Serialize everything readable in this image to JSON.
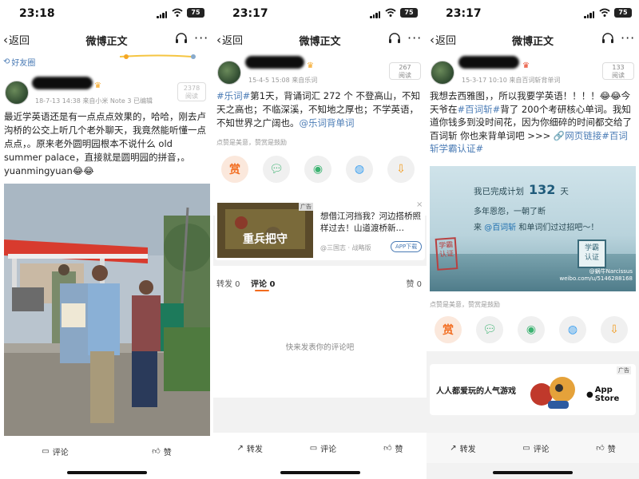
{
  "panels": [
    {
      "status": {
        "time": "23:18",
        "battery": "75"
      },
      "nav": {
        "back_label": "返回",
        "title": "微博正文"
      },
      "friends_label": "好友圈",
      "post": {
        "meta_date": "18-7-13 14:38",
        "meta_source": "来自小米 Note 3",
        "meta_edited": "已编辑",
        "read_count": "2378",
        "read_label": "阅读",
        "text_line1": "最近学英语还是有一点点点效果的，哈哈，刚去卢沟桥的公交上听几个老外聊天，我竟然能听懂一点点点，。原来老外圆明园根本不说什么 old summer palace，直接就是圆明园的拼音，。",
        "text_line2": "yuanmingyuan😂😂"
      },
      "bottom": {
        "comment_label": "评论",
        "like_label": "赞"
      }
    },
    {
      "status": {
        "time": "23:17",
        "battery": "75"
      },
      "nav": {
        "back_label": "返回",
        "title": "微博正文"
      },
      "post": {
        "meta_date": "15-4-5 15:08",
        "meta_source": "来自乐词",
        "read_count": "267",
        "read_label": "阅读",
        "hashtag": "#乐词#",
        "text": "第1天，背诵词汇 272 个 不登高山，不知天之高也；不临深溪，不知地之厚也；不学英语，不知世界之广阔也。",
        "mention": "@乐词背单词"
      },
      "tip": "点赞是美意，赞赏是鼓励",
      "reward_label": "赏",
      "ad": {
        "badge": "广告",
        "image_text": "重兵把守",
        "title": "想借江河挡我？河边搭桥照样过去！山道渡桥新…",
        "source": "@三国志 · 战略版",
        "button": "APP下载"
      },
      "tabs": {
        "repost": "转发 0",
        "comment": "评论 0",
        "like": "赞 0"
      },
      "empty_comment": "快来发表你的评论吧",
      "bottom": {
        "repost_label": "转发",
        "comment_label": "评论",
        "like_label": "赞"
      }
    },
    {
      "status": {
        "time": "23:17",
        "battery": "75"
      },
      "nav": {
        "back_label": "返回",
        "title": "微博正文"
      },
      "post": {
        "meta_date": "15-3-17 10:10",
        "meta_source": "来自百词斩背单词",
        "read_count": "133",
        "read_label": "阅读",
        "text1": "我想去西雅图，，所以我要学英语！！！！😂😂今天爷在",
        "hashtag1": "#百词斩#",
        "text2": "背了 200个考研核心单词。我知道你钱多到没时间花，因为你细碎的时间都交给了百词斩 你也来背单词吧 >>> ",
        "weblink": "🔗网页链接",
        "hashtag2": "#百词斩学霸认证#"
      },
      "image": {
        "done_prefix": "我已完成计划",
        "days": "132",
        "days_unit": "天",
        "line2": "多年恩怨，一朝了断",
        "line3_prefix": "来",
        "line3_mention": "@百词斩",
        "line3_suffix": "和单词们过过招吧～！",
        "seal": "学霸认证",
        "watermark": "@蜗牛Narcissus",
        "watermark_url": "weibo.com/u/5146288168"
      },
      "tip": "点赞是美意，赞赏是鼓励",
      "reward_label": "赏",
      "ad": {
        "text": "人人都爱玩的人气游戏",
        "badge": "广告",
        "store": "App Store"
      },
      "bottom": {
        "repost_label": "转发",
        "comment_label": "评论",
        "like_label": "赞"
      }
    }
  ],
  "colors": {
    "link": "#4a7bb5",
    "reward_orange": "#f26b1d",
    "wechat_green": "#3cb371",
    "qq_blue": "#3a9ff0",
    "download_orange": "#f29b1d"
  }
}
